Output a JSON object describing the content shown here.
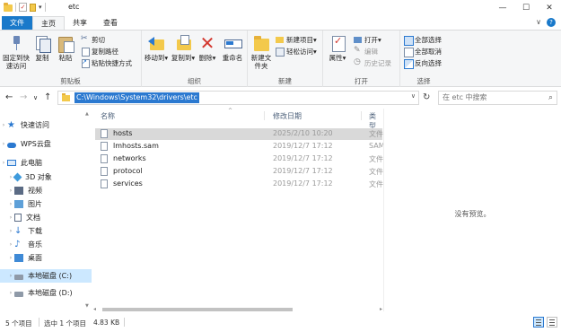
{
  "window": {
    "title": "etc",
    "minimize_glyph": "—",
    "maximize_glyph": "☐",
    "close_glyph": "✕",
    "qat_dropdown_glyph": "▾"
  },
  "tabs": [
    {
      "label": "文件"
    },
    {
      "label": "主页"
    },
    {
      "label": "共享"
    },
    {
      "label": "查看"
    }
  ],
  "ribbon_right": {
    "expand_glyph": "∨",
    "help_glyph": "?"
  },
  "ribbon": {
    "clipboard": {
      "pin_label": "固定到快速访问",
      "copy_label": "复制",
      "paste_label": "粘贴",
      "cut_label": "剪切",
      "copy_path_label": "复制路径",
      "paste_shortcut_label": "粘贴快捷方式",
      "group_label": "剪贴板"
    },
    "organize": {
      "move_label": "移动到",
      "copy_to_label": "复制到",
      "delete_label": "删除",
      "rename_label": "重命名",
      "group_label": "组织"
    },
    "new": {
      "new_folder_label": "新建文件夹",
      "new_item_label": "新建项目",
      "easy_access_label": "轻松访问",
      "group_label": "新建"
    },
    "open": {
      "properties_label": "属性",
      "open_label": "打开",
      "edit_label": "编辑",
      "history_label": "历史记录",
      "group_label": "打开"
    },
    "select": {
      "select_all_label": "全部选择",
      "select_none_label": "全部取消",
      "invert_label": "反向选择",
      "group_label": "选择"
    },
    "dropdown_glyph": "▾"
  },
  "address": {
    "back_glyph": "←",
    "forward_glyph": "→",
    "recent_glyph": "∨",
    "up_glyph": "↑",
    "path": "C:\\Windows\\System32\\drivers\\etc",
    "dropdown_glyph": "∨",
    "refresh_glyph": "↻",
    "search_placeholder": "在 etc 中搜索",
    "search_glyph": "⌕"
  },
  "navigation": {
    "items": [
      {
        "label": "快速访问",
        "icon": "star-icon"
      },
      {
        "label": "WPS云盘",
        "icon": "cloud-icon"
      },
      {
        "label": "此电脑",
        "icon": "computer-icon"
      },
      {
        "label": "3D 对象",
        "icon": "3d-objects-icon"
      },
      {
        "label": "视频",
        "icon": "video-icon"
      },
      {
        "label": "图片",
        "icon": "pictures-icon"
      },
      {
        "label": "文档",
        "icon": "documents-icon"
      },
      {
        "label": "下载",
        "icon": "download-icon"
      },
      {
        "label": "音乐",
        "icon": "music-icon"
      },
      {
        "label": "桌面",
        "icon": "desktop-icon"
      },
      {
        "label": "本地磁盘 (C:)",
        "icon": "drive-icon"
      },
      {
        "label": "本地磁盘 (D:)",
        "icon": "drive-icon"
      }
    ],
    "selected_index": 10,
    "caret_glyph": "›",
    "star_glyph": "★",
    "download_glyph": "↓",
    "music_glyph": "♪"
  },
  "filelist": {
    "columns": {
      "name": "名称",
      "date": "修改日期",
      "type": "类型"
    },
    "sort_glyph": "^",
    "scroll_left_glyph": "◂",
    "scroll_right_glyph": "▸",
    "rows": [
      {
        "name": "hosts",
        "date": "2025/2/10 10:20",
        "type": "文件"
      },
      {
        "name": "lmhosts.sam",
        "date": "2019/12/7 17:12",
        "type": "SAM"
      },
      {
        "name": "networks",
        "date": "2019/12/7 17:12",
        "type": "文件"
      },
      {
        "name": "protocol",
        "date": "2019/12/7 17:12",
        "type": "文件"
      },
      {
        "name": "services",
        "date": "2019/12/7 17:12",
        "type": "文件"
      }
    ],
    "selected_index": 0
  },
  "preview": {
    "text": "没有预览。"
  },
  "status": {
    "item_count": "5 个项目",
    "selected_count": "选中 1 个项目",
    "selected_size": "4.83 KB"
  },
  "colors": {
    "accent": "#1979ca",
    "selection": "#cce8ff",
    "folder": "#f3c94b",
    "delete_red": "#d3382f"
  }
}
